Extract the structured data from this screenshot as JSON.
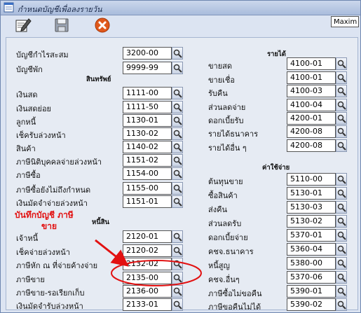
{
  "window": {
    "title": "กำหนดบัญชีเพื่อลงรายวัน",
    "maximize_label": "Maxim"
  },
  "toolbar": {
    "edit_icon": "edit-icon",
    "save_icon": "save-icon",
    "cancel_icon": "cancel-icon"
  },
  "colors": {
    "cancel_button": "#e0581b",
    "annotation": "#e21111",
    "panel": "#e6ebf3"
  },
  "left": {
    "rows": [
      {
        "label": "บัญชีกำไรสะสม",
        "value": "3200-00"
      },
      {
        "label": "บัญชีพัก",
        "value": "9999-99"
      }
    ],
    "assets_title": "สินทรัพย์",
    "assets": [
      {
        "label": "เงินสด",
        "value": "1111-00"
      },
      {
        "label": "เงินสดย่อย",
        "value": "1111-50"
      },
      {
        "label": "ลูกหนี้",
        "value": "1130-01"
      },
      {
        "label": "เช็ครับล่วงหน้า",
        "value": "1130-02"
      },
      {
        "label": "สินค้า",
        "value": "1140-02"
      },
      {
        "label": "ภาษีนิติบุคคลจ่ายล่วงหน้า",
        "value": "1151-02"
      },
      {
        "label": "ภาษีซื้อ",
        "value": "1154-00"
      },
      {
        "label": "ภาษีซื้อยังไม่ถึงกำหนด",
        "value": "1155-00"
      },
      {
        "label": "เงินมัดจำจ่ายล่วงหน้า",
        "value": "1151-01"
      }
    ],
    "liabilities_title": "หนี้สิน",
    "liabilities": [
      {
        "label": "เจ้าหนี้",
        "value": "2120-01"
      },
      {
        "label": "เช็คจ่ายล่วงหน้า",
        "value": "2120-02"
      },
      {
        "label": "ภาษีหัก ณ ที่จ่ายค้างจ่าย",
        "value": "2132-02"
      },
      {
        "label": "ภาษีขาย",
        "value": "2135-00"
      },
      {
        "label": "ภาษีขาย-รอเรียกเก็บ",
        "value": "2136-00"
      },
      {
        "label": "เงินมัดจำรับล่วงหน้า",
        "value": "2133-01"
      }
    ]
  },
  "right": {
    "income_title": "รายได้",
    "income": [
      {
        "label": "ขายสด",
        "value": "4100-01"
      },
      {
        "label": "ขายเชื่อ",
        "value": "4100-01"
      },
      {
        "label": "รับคืน",
        "value": "4100-03"
      },
      {
        "label": "ส่วนลดจ่าย",
        "value": "4100-04"
      },
      {
        "label": "ดอกเบี้ยรับ",
        "value": "4200-01"
      },
      {
        "label": "รายได้ธนาคาร",
        "value": "4200-08"
      },
      {
        "label": "รายได้อื่น ๆ",
        "value": "4200-08"
      }
    ],
    "expense_title": "ค่าใช้จ่าย",
    "expenses": [
      {
        "label": "ต้นทุนขาย",
        "value": "5110-00"
      },
      {
        "label": "ซื้อสินค้า",
        "value": "5130-01"
      },
      {
        "label": "ส่งคืน",
        "value": "5130-03"
      },
      {
        "label": "ส่วนลดรับ",
        "value": "5130-02"
      },
      {
        "label": "ดอกเบี้ยจ่าย",
        "value": "5370-01"
      },
      {
        "label": "คชจ.ธนาคาร",
        "value": "5360-04"
      },
      {
        "label": "หนี้สูญ",
        "value": "5380-00"
      },
      {
        "label": "คชจ.อื่นๆ",
        "value": "5370-06"
      },
      {
        "label": "ภาษีซื้อไม่ขอคืน",
        "value": "5390-01"
      },
      {
        "label": "ภาษีขอคืนไม่ได้",
        "value": "5390-02"
      }
    ]
  },
  "annotation": {
    "line1": "บันทึกบัญชี ภาษี",
    "line2": "ขาย"
  }
}
